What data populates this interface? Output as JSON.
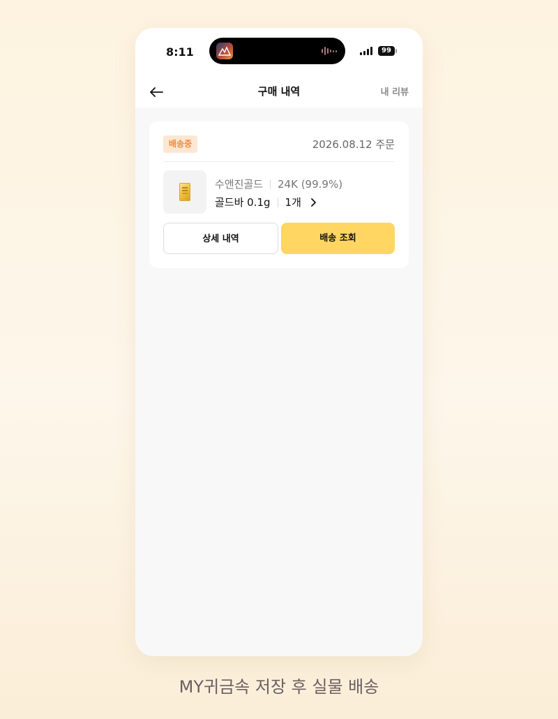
{
  "status_bar": {
    "time": "8:11",
    "battery": "99"
  },
  "nav": {
    "title": "구매 내역",
    "review_link": "내 리뷰"
  },
  "order": {
    "status_badge": "배송중",
    "date": "2026.08.12 주문",
    "product": {
      "brand": "수앤진골드",
      "purity": "24K (99.9%)",
      "name": "골드바 0.1g",
      "quantity": "1개"
    },
    "buttons": {
      "detail": "상세 내역",
      "tracking": "배송 조회"
    }
  },
  "caption": "MY귀금속 저장 후 실물 배송",
  "colors": {
    "accent_button": "#ffd662",
    "badge_bg": "#fde7d3",
    "badge_text": "#ee8a3a"
  },
  "icons": [
    "back-arrow-icon",
    "chevron-right-icon",
    "signal-icon",
    "battery-icon",
    "gold-bar-thumbnail"
  ]
}
